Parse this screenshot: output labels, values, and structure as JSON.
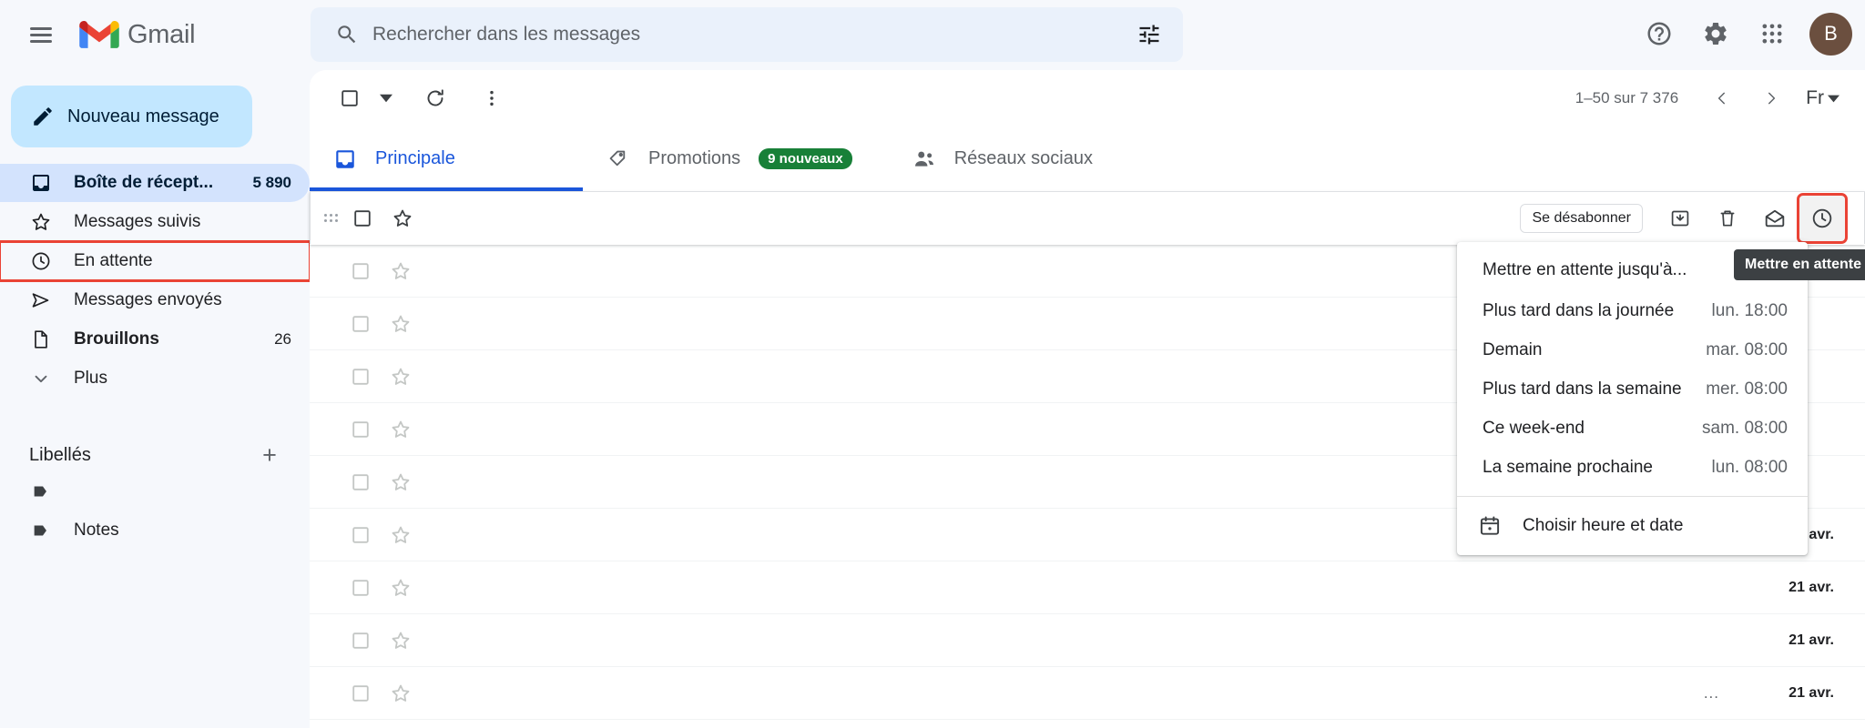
{
  "app": {
    "brand": "Gmail",
    "avatar_initial": "B"
  },
  "topbar": {
    "menu_icon": "hamburger-icon",
    "search": {
      "placeholder": "Rechercher dans les messages",
      "value": "",
      "search_icon": "search-icon",
      "filter_icon": "tune-filter-icon"
    },
    "help_icon": "help-circle-icon",
    "settings_icon": "gear-icon",
    "apps_icon": "apps-grid-icon"
  },
  "sidebar": {
    "compose_label": "Nouveau message",
    "compose_icon": "pencil-icon",
    "items": [
      {
        "label": "Boîte de récept...",
        "count": "5 890",
        "icon": "inbox-icon",
        "active": true,
        "highlighted": false,
        "bold": true
      },
      {
        "label": "Messages suivis",
        "count": "",
        "icon": "star-icon",
        "active": false,
        "highlighted": false,
        "bold": false
      },
      {
        "label": "En attente",
        "count": "",
        "icon": "clock-icon",
        "active": false,
        "highlighted": true,
        "bold": false
      },
      {
        "label": "Messages envoyés",
        "count": "",
        "icon": "send-icon",
        "active": false,
        "highlighted": false,
        "bold": false
      },
      {
        "label": "Brouillons",
        "count": "26",
        "icon": "draft-icon",
        "active": false,
        "highlighted": false,
        "bold": true
      },
      {
        "label": "Plus",
        "count": "",
        "icon": "chevron-down-icon",
        "active": false,
        "highlighted": false,
        "bold": false
      }
    ],
    "labels_title": "Libellés",
    "add_label_icon": "plus-icon",
    "labels": [
      {
        "name": "",
        "icon": "label-tag-icon"
      },
      {
        "name": "Notes",
        "icon": "label-tag-icon"
      }
    ]
  },
  "toolbar": {
    "select_all_icon": "checkbox-icon",
    "select_caret_icon": "chevron-down-icon",
    "refresh_icon": "refresh-icon",
    "more_icon": "more-vertical-icon",
    "page_range": "1–50 sur 7 376",
    "prev_icon": "chevron-left-icon",
    "next_icon": "chevron-right-icon",
    "density_label": "Fr",
    "density_caret_icon": "chevron-down-icon"
  },
  "tabs": [
    {
      "label": "Principale",
      "icon": "inbox-icon",
      "badge": "",
      "active": true
    },
    {
      "label": "Promotions",
      "icon": "tag-icon",
      "badge": "9 nouveaux",
      "active": false
    },
    {
      "label": "Réseaux sociaux",
      "icon": "people-icon",
      "badge": "",
      "active": false
    }
  ],
  "row_actions": {
    "unsubscribe_label": "Se désabonner",
    "archive_icon": "archive-icon",
    "delete_icon": "trash-icon",
    "mark_read_icon": "mail-open-icon",
    "snooze_icon": "clock-icon"
  },
  "tooltip": {
    "text": "Mettre en attente"
  },
  "snooze_menu": {
    "header": "Mettre en attente jusqu'à...",
    "options": [
      {
        "label": "Plus tard dans la journée",
        "time": "lun. 18:00"
      },
      {
        "label": "Demain",
        "time": "mar. 08:00"
      },
      {
        "label": "Plus tard dans la semaine",
        "time": "mer. 08:00"
      },
      {
        "label": "Ce week-end",
        "time": "sam. 08:00"
      },
      {
        "label": "La semaine prochaine",
        "time": "lun. 08:00"
      }
    ],
    "custom_label": "Choisir heure et date",
    "custom_icon": "calendar-icon"
  },
  "rows": [
    {
      "date": "",
      "ellipsis": "",
      "hovered": true
    },
    {
      "date": "",
      "ellipsis": "",
      "hovered": false
    },
    {
      "date": "",
      "ellipsis": "",
      "hovered": false
    },
    {
      "date": "",
      "ellipsis": "",
      "hovered": false
    },
    {
      "date": "",
      "ellipsis": "",
      "hovered": false
    },
    {
      "date": "",
      "ellipsis": "",
      "hovered": false
    },
    {
      "date": "21 avr.",
      "ellipsis": "",
      "hovered": false
    },
    {
      "date": "21 avr.",
      "ellipsis": "",
      "hovered": false
    },
    {
      "date": "21 avr.",
      "ellipsis": "",
      "hovered": false
    },
    {
      "date": "21 avr.",
      "ellipsis": "...",
      "hovered": false
    }
  ],
  "colors": {
    "accent": "#1a56db",
    "highlight": "#ea4335",
    "compose_bg": "#c2e7ff",
    "active_nav_bg": "#d3e3fd",
    "badge_green": "#188038",
    "avatar_bg": "#6b4f3f"
  }
}
